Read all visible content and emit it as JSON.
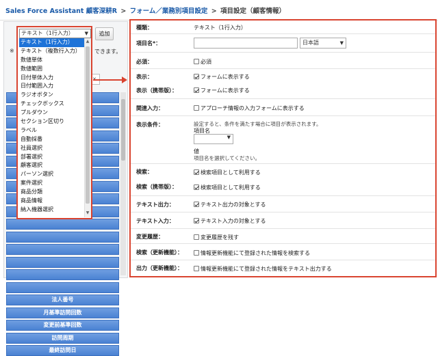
{
  "breadcrumb": {
    "app": "Sales Force Assistant 顧客深耕R",
    "sep": ">",
    "section": "フォーム／業務別項目設定",
    "current": "項目設定（顧客情報）"
  },
  "left": {
    "add_label": "追加",
    "note": "※",
    "note_tail": "できます。",
    "hidden_value": "x",
    "field_buttons": [
      "",
      "",
      "",
      "",
      "",
      "",
      "",
      "",
      "",
      "",
      "",
      "",
      "",
      "",
      "",
      "",
      "法人番号",
      "月基準訪問回数",
      "変更前基準回数",
      "訪問周期",
      "最終訪問日"
    ]
  },
  "dropdown": {
    "selected": "テキスト（1行入力）",
    "options": [
      "テキスト（1行入力）",
      "テキスト（複数行入力）",
      "数値単体",
      "数値範囲",
      "日付単体入力",
      "日付範囲入力",
      "ラジオボタン",
      "チェックボックス",
      "プルダウン",
      "セクション区切り",
      "ラベル",
      "自動採番",
      "社員選択",
      "部署選択",
      "顧客選択",
      "パーソン選択",
      "案件選択",
      "商品分類",
      "商品情報",
      "納入機器選択"
    ],
    "selected_index": 0
  },
  "settings": {
    "type_label": "種類：",
    "type_value": "テキスト（1行入力）",
    "name_label": "項目名*：",
    "name_value": "",
    "lang_value": "日本語",
    "required_label": "必須：",
    "required_text": "必須",
    "display_label": "表示：",
    "display_text": "フォームに表示する",
    "display_mobile_label": "表示（携帯版）：",
    "display_mobile_text": "フォームに表示する",
    "related_label": "関連入力：",
    "related_text": "アプローチ情報の入力フォームに表示する",
    "condition_label": "表示条件：",
    "condition_desc": "設定すると、条件を満たす場合に項目が表示されます。",
    "condition_field_label": "項目名",
    "condition_value_label": "値",
    "condition_hint": "項目名を選択してください。",
    "search_label": "検索：",
    "search_text": "検索項目として利用する",
    "search_mobile_label": "検索（携帯版）：",
    "search_mobile_text": "検索項目として利用する",
    "export_label": "テキスト出力：",
    "export_text": "テキスト出力の対象とする",
    "import_label": "テキスト入力：",
    "import_text": "テキスト入力の対象とする",
    "history_label": "変更履歴：",
    "history_text": "変更履歴を残す",
    "search_update_label": "検索（更新機能）：",
    "search_update_text": "情報更新機能にて登録された情報を検索する",
    "export_update_label": "出力（更新機能）：",
    "export_update_text": "情報更新機能にて登録された情報をテキスト出力する"
  },
  "colors": {
    "accent": "#d9432f",
    "selection": "#1e73d8",
    "field_button": "#4a82d3",
    "link": "#1a5aa8"
  }
}
